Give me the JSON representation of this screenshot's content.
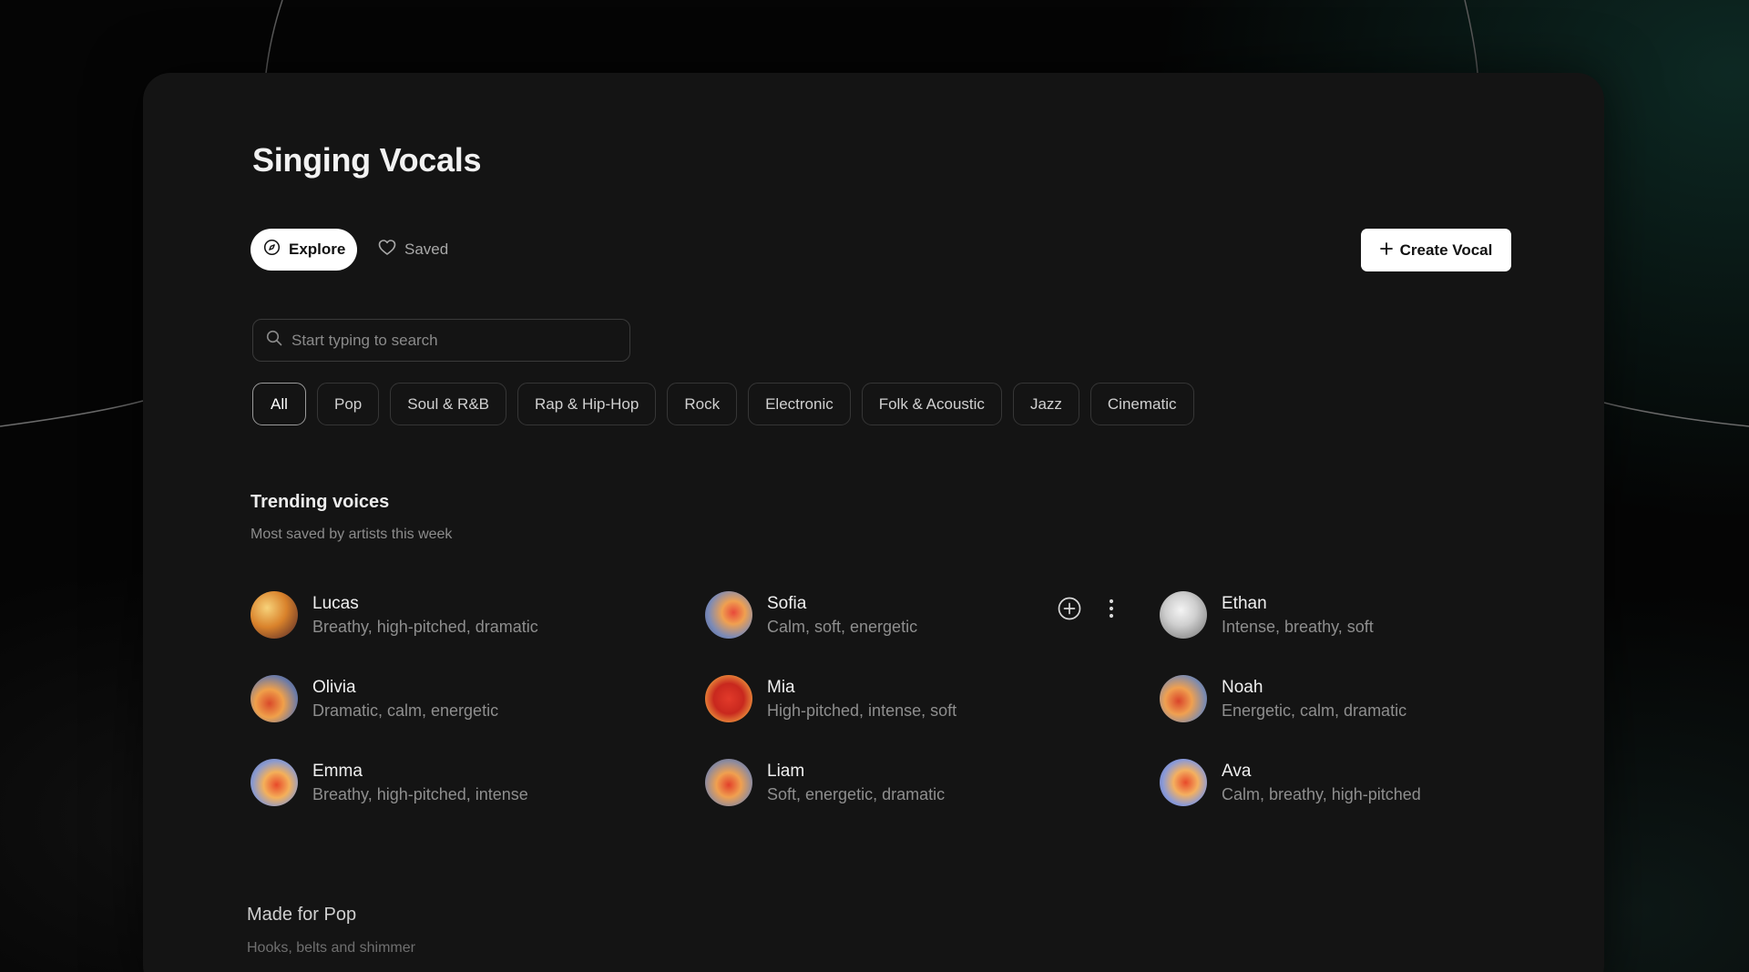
{
  "page": {
    "title": "Singing Vocals"
  },
  "tabs": [
    {
      "label": "Explore",
      "icon": "compass-icon",
      "active": true
    },
    {
      "label": "Saved",
      "icon": "heart-icon",
      "active": false
    }
  ],
  "actions": {
    "create_label": "Create Vocal"
  },
  "search": {
    "placeholder": "Start typing to search",
    "value": ""
  },
  "filters": [
    {
      "label": "All",
      "active": true
    },
    {
      "label": "Pop",
      "active": false
    },
    {
      "label": "Soul & R&B",
      "active": false
    },
    {
      "label": "Rap & Hip-Hop",
      "active": false
    },
    {
      "label": "Rock",
      "active": false
    },
    {
      "label": "Electronic",
      "active": false
    },
    {
      "label": "Folk & Acoustic",
      "active": false
    },
    {
      "label": "Jazz",
      "active": false
    },
    {
      "label": "Cinematic",
      "active": false
    }
  ],
  "trending": {
    "title": "Trending voices",
    "subtitle": "Most saved by artists this week",
    "voices": [
      {
        "name": "Lucas",
        "tags": "Breathy, high-pitched, dramatic"
      },
      {
        "name": "Sofia",
        "tags": "Calm, soft, energetic"
      },
      {
        "name": "Ethan",
        "tags": "Intense, breathy, soft"
      },
      {
        "name": "Olivia",
        "tags": "Dramatic, calm, energetic"
      },
      {
        "name": "Mia",
        "tags": "High-pitched, intense, soft"
      },
      {
        "name": "Noah",
        "tags": "Energetic, calm, dramatic"
      },
      {
        "name": "Emma",
        "tags": "Breathy, high-pitched, intense"
      },
      {
        "name": "Liam",
        "tags": "Soft, energetic, dramatic"
      },
      {
        "name": "Ava",
        "tags": "Calm, breathy, high-pitched"
      }
    ]
  },
  "made_for_pop": {
    "title": "Made for Pop",
    "subtitle": "Hooks, belts and shimmer"
  },
  "hover_actions": {
    "add_icon": "plus-circle-icon",
    "more_icon": "more-vertical-icon"
  }
}
